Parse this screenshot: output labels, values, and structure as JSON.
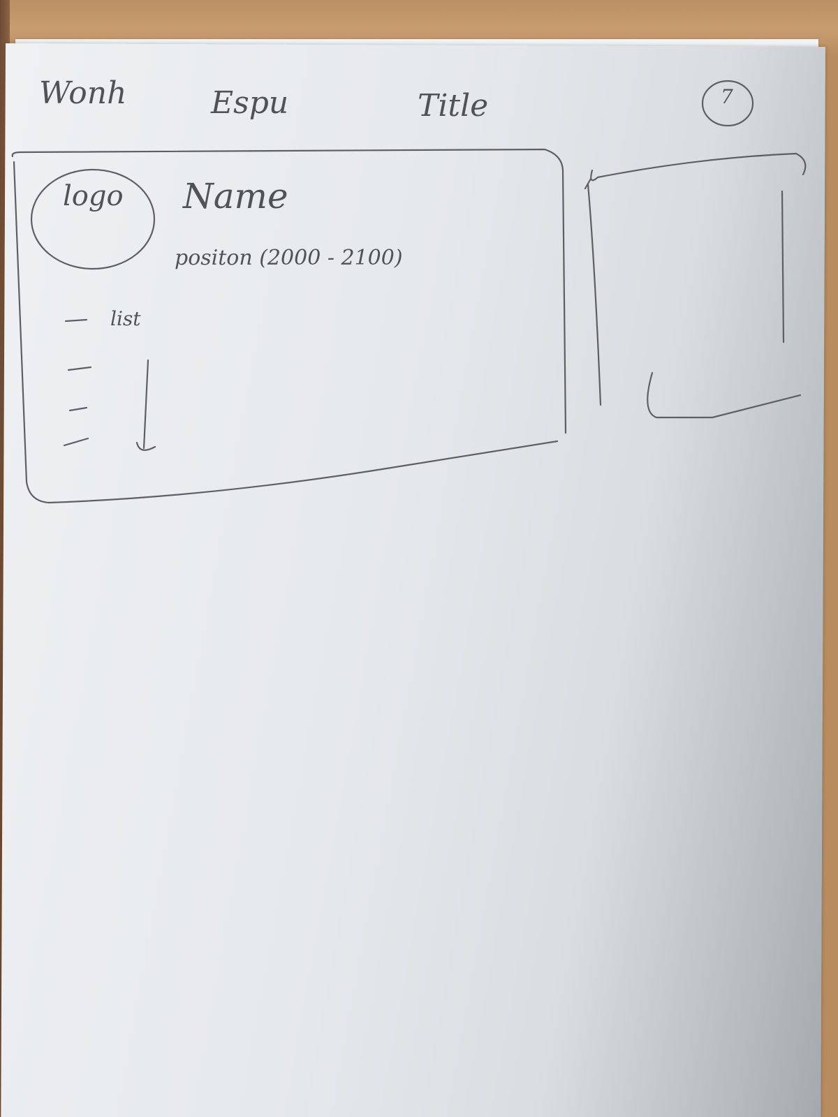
{
  "nav": {
    "items": [
      "Wonh",
      "Espu",
      "Title"
    ],
    "badge": "7"
  },
  "card": {
    "logo_label": "logo",
    "name": "Name",
    "position": "positon (2000 - 2100)",
    "list_label": "list"
  },
  "colors": {
    "pencil": "#5d5f62",
    "paper": "#e9ebed"
  }
}
